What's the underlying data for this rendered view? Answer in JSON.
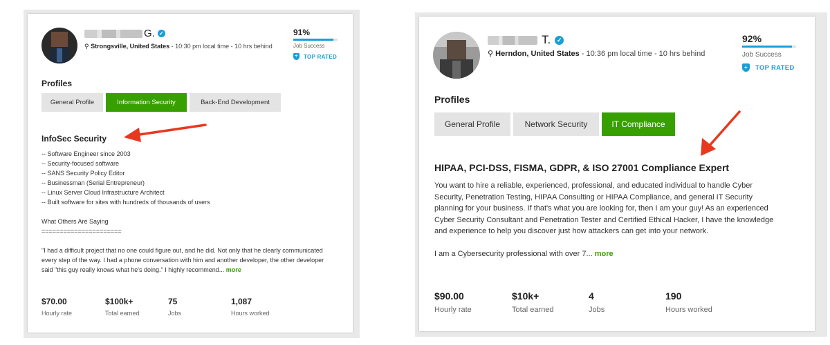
{
  "left": {
    "name_initial": "G.",
    "location": "Strongsville, United States",
    "local_time": "10:30 pm local time - 10 hrs behind",
    "job_success_pct": "91%",
    "job_success_value": 0.91,
    "job_success_label": "Job Success",
    "top_rated": "TOP RATED",
    "profiles_heading": "Profiles",
    "tabs": [
      {
        "label": "General Profile",
        "active": false
      },
      {
        "label": "Information Security",
        "active": true
      },
      {
        "label": "Back-End Development",
        "active": false
      }
    ],
    "title": "InfoSec Security",
    "bullets": [
      "-- Software Engineer since 2003",
      "-- Security-focused software",
      "-- SANS Security Policy Editor",
      "-- Businessman (Serial Entrepreneur)",
      "-- Linux Server Cloud Infrastructure Architect",
      "-- Built software for sites with hundreds of thousands of users"
    ],
    "others_heading": "What Others Are Saying",
    "separator": "======================",
    "quote": "\"I had a difficult project that no one could figure out, and he did. Not only that he clearly communicated every step of the way. I had a phone conversation with him and another developer, the other developer said \"this guy really knows what he's doing.\" I highly recommend...",
    "more": "more",
    "stats": [
      {
        "value": "$70.00",
        "label": "Hourly rate"
      },
      {
        "value": "$100k+",
        "label": "Total earned"
      },
      {
        "value": "75",
        "label": "Jobs"
      },
      {
        "value": "1,087",
        "label": "Hours worked"
      }
    ]
  },
  "right": {
    "name_initial": "T.",
    "location": "Herndon, United States",
    "local_time": "10:36 pm local time - 10 hrs behind",
    "job_success_pct": "92%",
    "job_success_value": 0.92,
    "job_success_label": "Job Success",
    "top_rated": "TOP RATED",
    "profiles_heading": "Profiles",
    "tabs": [
      {
        "label": "General Profile",
        "active": false
      },
      {
        "label": "Network Security",
        "active": false
      },
      {
        "label": "IT Compliance",
        "active": true
      }
    ],
    "title": "HIPAA, PCI-DSS, FISMA, GDPR, & ISO 27001 Compliance Expert",
    "paragraph": "You want to hire a reliable, experienced, professional, and educated individual to handle Cyber Security, Penetration Testing, HIPAA Consulting or HIPAA Compliance, and general IT Security planning for your business. If that's what you are looking for, then I am your guy! As an experienced Cyber Security Consultant and Penetration Tester and Certified Ethical Hacker, I have the knowledge and experience to help you discover just how attackers can get into your network.",
    "teaser": "I am a Cybersecurity professional with over 7...",
    "more": "more",
    "stats": [
      {
        "value": "$90.00",
        "label": "Hourly rate"
      },
      {
        "value": "$10k+",
        "label": "Total earned"
      },
      {
        "value": "4",
        "label": "Jobs"
      },
      {
        "value": "190",
        "label": "Hours worked"
      }
    ]
  },
  "colors": {
    "accent_green": "#37a000",
    "accent_blue": "#1a9ed9",
    "arrow_red": "#e8381f"
  }
}
